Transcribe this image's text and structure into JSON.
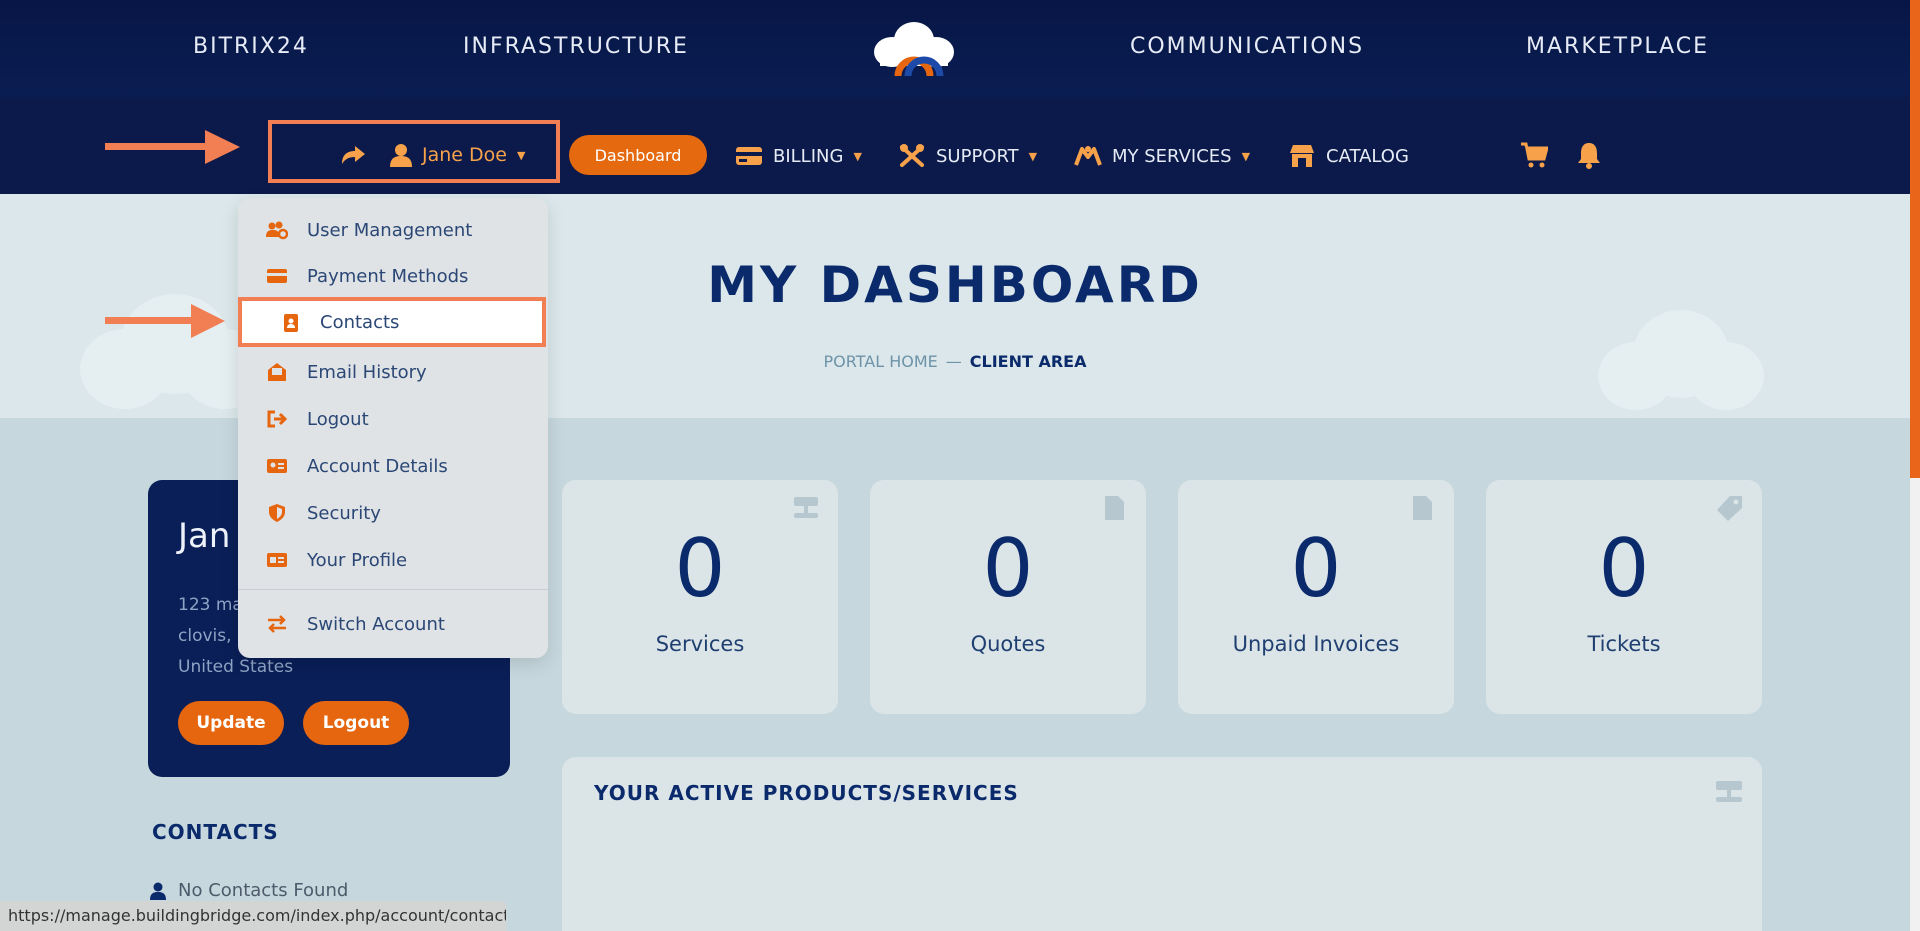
{
  "topnav": {
    "links": [
      "BITRIX24",
      "INFRASTRUCTURE",
      "COMMUNICATIONS",
      "MARKETPLACE"
    ]
  },
  "subnav": {
    "user_label": "Jane Doe",
    "dashboard_label": "Dashboard",
    "billing_label": "BILLING",
    "support_label": "SUPPORT",
    "my_services_label": "MY SERVICES",
    "catalog_label": "CATALOG"
  },
  "dropdown": {
    "items": [
      {
        "label": "User Management",
        "icon": "users-gear-icon"
      },
      {
        "label": "Payment Methods",
        "icon": "credit-card-icon"
      },
      {
        "label": "Contacts",
        "icon": "address-book-icon"
      },
      {
        "label": "Email History",
        "icon": "envelope-open-icon"
      },
      {
        "label": "Logout",
        "icon": "sign-out-icon"
      },
      {
        "label": "Account Details",
        "icon": "id-card-icon"
      },
      {
        "label": "Security",
        "icon": "shield-icon"
      },
      {
        "label": "Your Profile",
        "icon": "profile-card-icon"
      }
    ],
    "switch_account": "Switch Account"
  },
  "hero": {
    "title": "MY DASHBOARD",
    "breadcrumb": {
      "home": "PORTAL HOME",
      "separator": "—",
      "current": "CLIENT AREA"
    }
  },
  "profile": {
    "name": "Jan",
    "address_lines": [
      "123 ma",
      "clovis,",
      "United States"
    ],
    "update_label": "Update",
    "logout_label": "Logout"
  },
  "contacts": {
    "heading": "CONTACTS",
    "empty_text": "No Contacts Found"
  },
  "stats": [
    {
      "value": "0",
      "label": "Services",
      "icon": "server-icon"
    },
    {
      "value": "0",
      "label": "Quotes",
      "icon": "document-icon"
    },
    {
      "value": "0",
      "label": "Unpaid Invoices",
      "icon": "document-icon"
    },
    {
      "value": "0",
      "label": "Tickets",
      "icon": "tag-icon"
    }
  ],
  "products": {
    "title": "YOUR ACTIVE PRODUCTS/SERVICES"
  },
  "status_url": "https://manage.buildingbridge.com/index.php/account/contacts",
  "colors": {
    "navy": "#0a1d52",
    "accent_orange": "#e5660f",
    "annotation": "#f27f53",
    "heading_blue": "#0a2a6b"
  }
}
